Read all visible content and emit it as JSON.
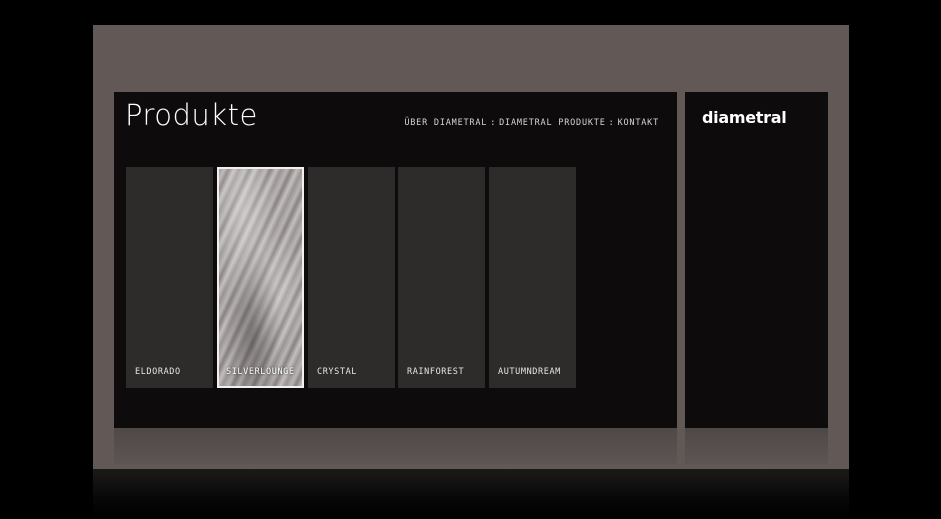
{
  "header": {
    "title": "Produkte",
    "nav": [
      {
        "label": "ÜBER DIAMETRAL"
      },
      {
        "label": "DIAMETRAL PRODUKTE"
      },
      {
        "label": "KONTAKT"
      }
    ],
    "nav_separator": ":"
  },
  "products": [
    {
      "label": "ELDORADO",
      "selected": false
    },
    {
      "label": "SILVERLOUNGE",
      "selected": true
    },
    {
      "label": "CRYSTAL",
      "selected": false
    },
    {
      "label": "RAINFOREST",
      "selected": false
    },
    {
      "label": "AUTUMNDREAM",
      "selected": false
    }
  ],
  "brand": {
    "logo_text": "diametral"
  },
  "colors": {
    "frame": "#625957",
    "panel": "#0d0b0b",
    "tile": "#2e2b2b",
    "text": "#ffffff"
  }
}
